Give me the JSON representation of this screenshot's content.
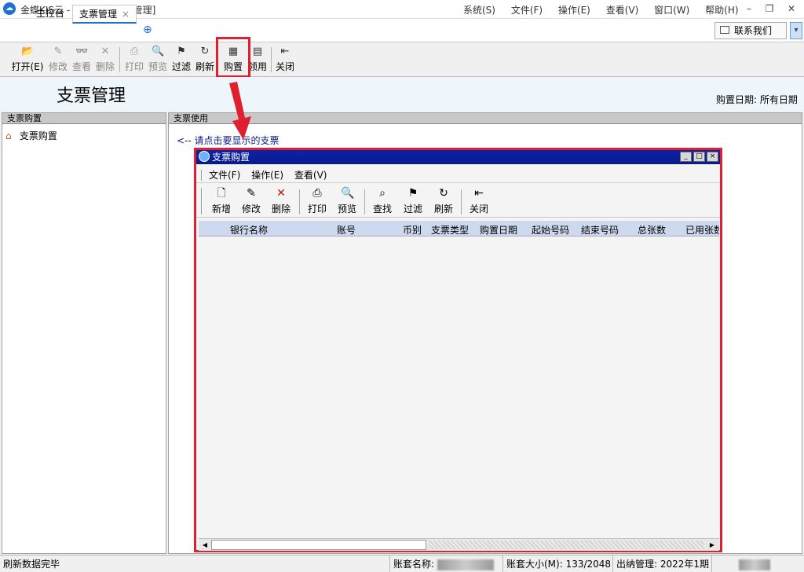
{
  "app": {
    "title": "金蝶KIS云 - 专业版 - [支票管理]"
  },
  "top_menu": [
    "系统(S)",
    "文件(F)",
    "操作(E)",
    "查看(V)",
    "窗口(W)",
    "帮助(H)"
  ],
  "window_controls": {
    "minimize": "–",
    "restore": "❐",
    "close": "✕"
  },
  "tabs": [
    {
      "label": "主控台"
    },
    {
      "label": "支票管理"
    }
  ],
  "tab_close": "×",
  "tab_add": "⊕",
  "contact_button": "联系我们",
  "dropdown_glyph": "▾",
  "toolbar": [
    {
      "label": "打开(E)",
      "icon": "📂",
      "name": "open"
    },
    {
      "label": "修改",
      "icon": "✎",
      "name": "edit"
    },
    {
      "label": "查看",
      "icon": "👓",
      "name": "view"
    },
    {
      "label": "删除",
      "icon": "✕",
      "name": "delete"
    },
    {
      "label": "打印",
      "icon": "⎙",
      "name": "print"
    },
    {
      "label": "预览",
      "icon": "🔍",
      "name": "preview"
    },
    {
      "label": "过滤",
      "icon": "⚑",
      "name": "filter"
    },
    {
      "label": "刷新",
      "icon": "↻",
      "name": "refresh"
    },
    {
      "label": "购置",
      "icon": "▦",
      "name": "purchase"
    },
    {
      "label": "领用",
      "icon": "▤",
      "name": "receive"
    },
    {
      "label": "关闭",
      "icon": "⇤",
      "name": "close"
    }
  ],
  "page": {
    "title": "支票管理",
    "purchase_date": "购置日期: 所有日期"
  },
  "left_panel": {
    "header": "支票购置",
    "tree_item": "支票购置"
  },
  "right_panel": {
    "header": "支票使用",
    "hint": "<-- 请点击要显示的支票"
  },
  "dialog": {
    "title": "支票购置",
    "controls": {
      "minimize": "_",
      "maximize": "□",
      "close": "×"
    },
    "menu": [
      "文件(F)",
      "操作(E)",
      "查看(V)"
    ],
    "toolbar": [
      {
        "label": "新增",
        "icon": "🗋",
        "name": "new"
      },
      {
        "label": "修改",
        "icon": "✎",
        "name": "edit"
      },
      {
        "label": "删除",
        "icon": "✕",
        "name": "delete"
      },
      {
        "label": "打印",
        "icon": "⎙",
        "name": "print"
      },
      {
        "label": "预览",
        "icon": "🔍",
        "name": "preview"
      },
      {
        "label": "查找",
        "icon": "⌕",
        "name": "find"
      },
      {
        "label": "过滤",
        "icon": "⚑",
        "name": "filter"
      },
      {
        "label": "刷新",
        "icon": "↻",
        "name": "refresh"
      },
      {
        "label": "关闭",
        "icon": "⇤",
        "name": "close"
      }
    ],
    "columns": [
      "银行名称",
      "账号",
      "币别",
      "支票类型",
      "购置日期",
      "起始号码",
      "结束号码",
      "总张数",
      "已用张数"
    ],
    "scroll_left": "◀",
    "scroll_right": "▶"
  },
  "status": {
    "message": "刷新数据完毕",
    "account_name_label": "账套名称:",
    "account_size": "账套大小(M): 133/2048",
    "cashier_period": "出纳管理: 2022年1期"
  },
  "colors": {
    "highlight": "#e0202e",
    "dialog_title": "#0a24a8",
    "grid_header": "#cdd9ef"
  }
}
